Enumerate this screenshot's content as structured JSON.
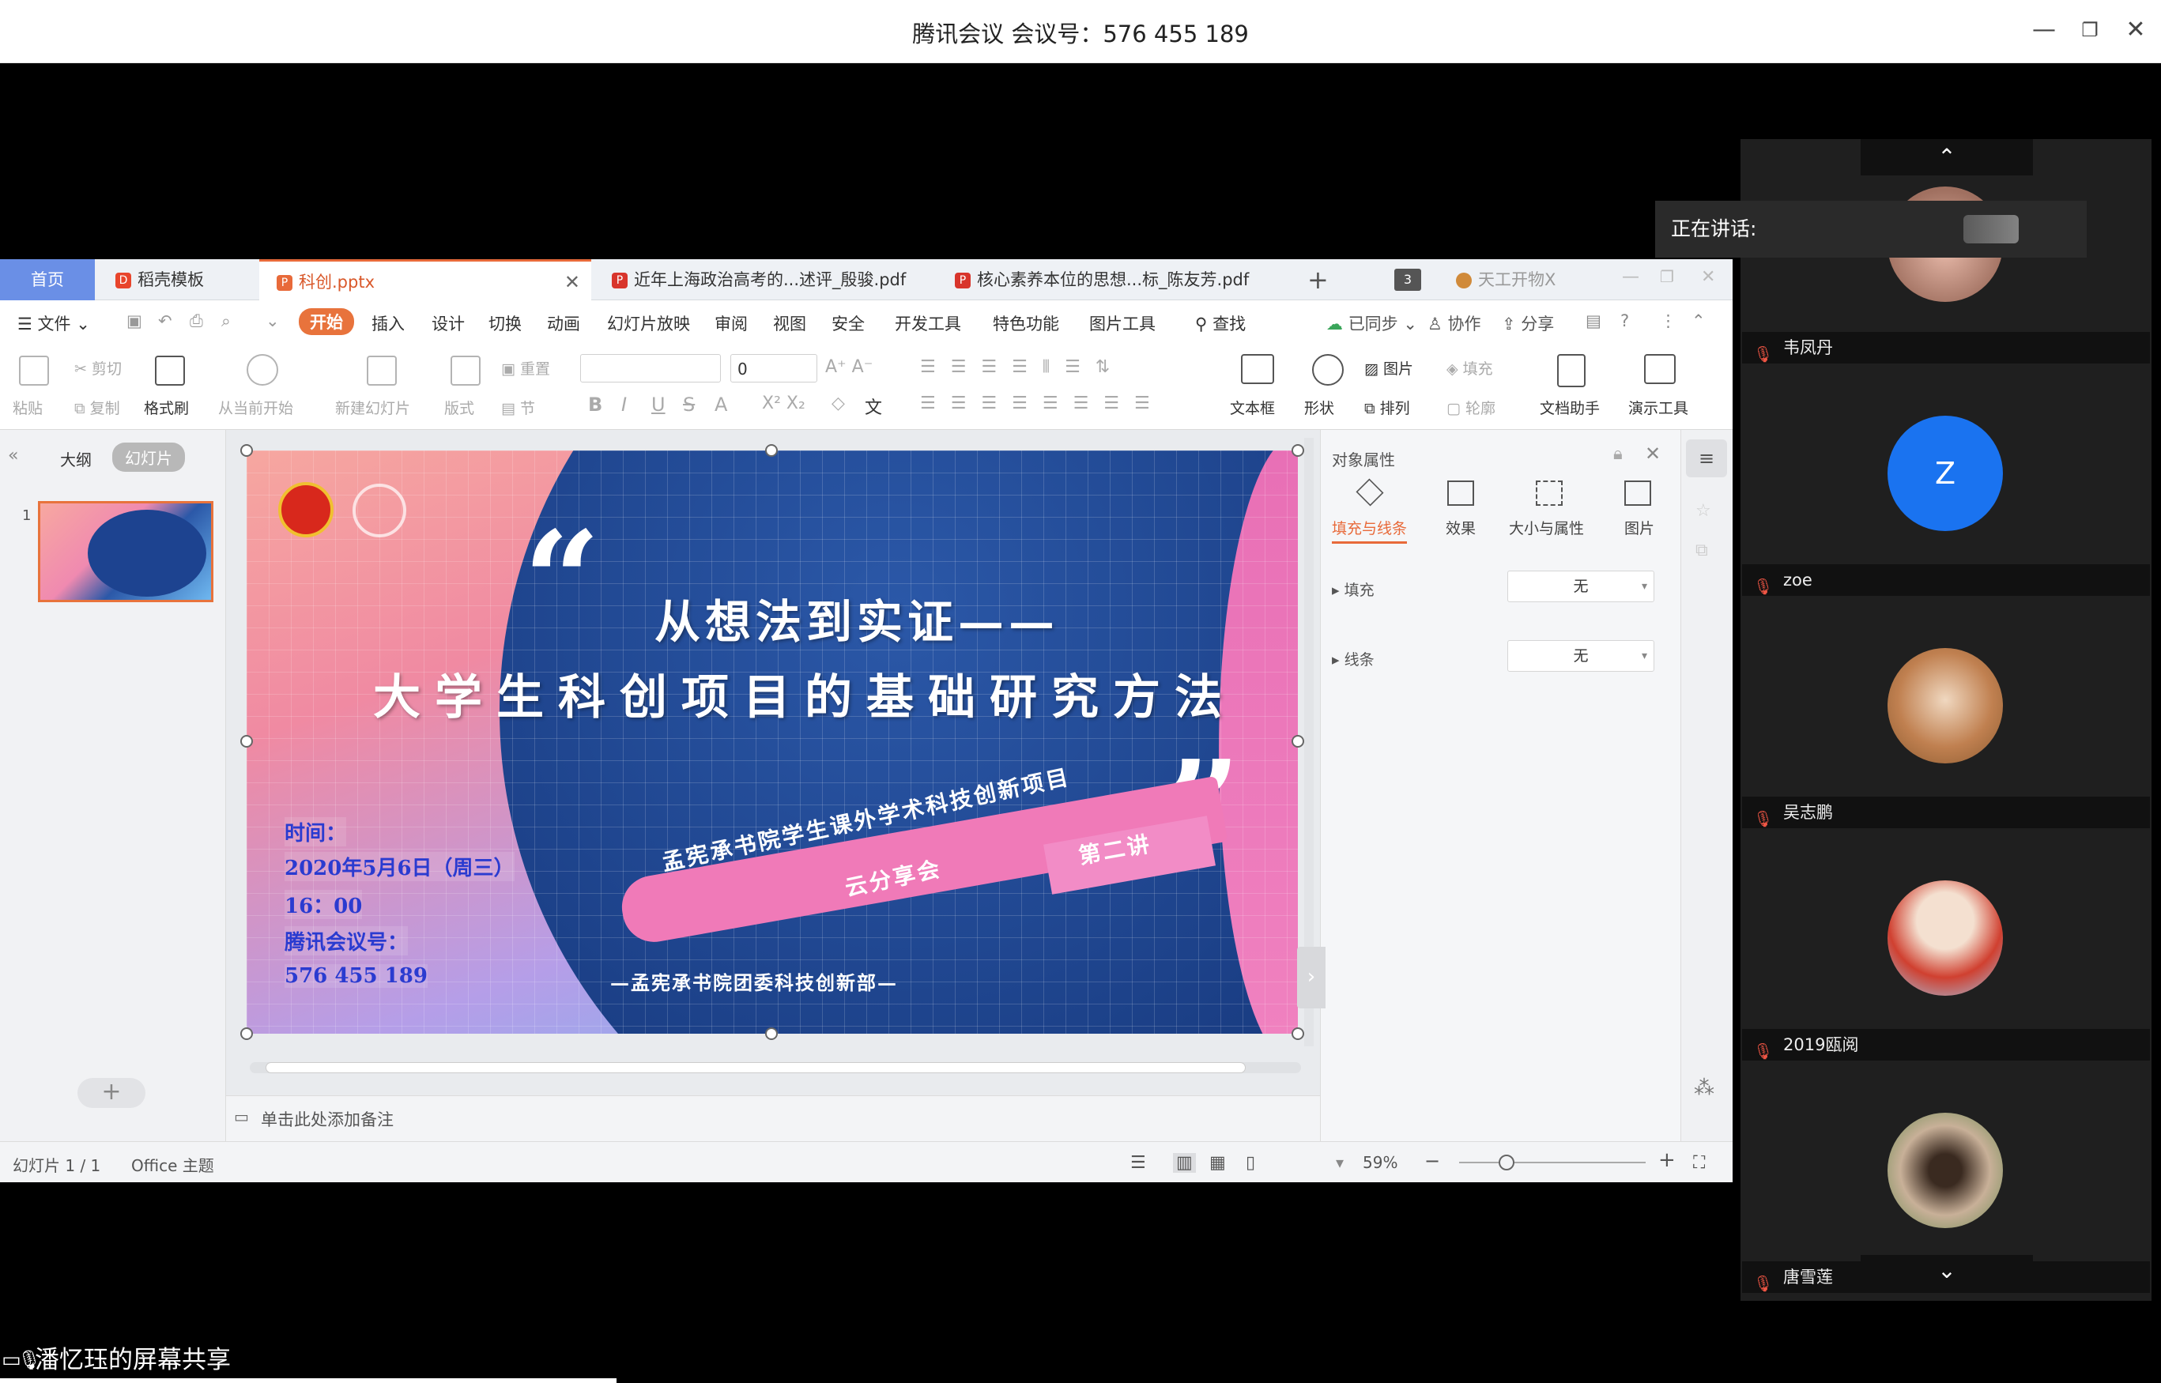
{
  "app": {
    "title": "腾讯会议 会议号：576 455 189"
  },
  "tabs": [
    {
      "label": "首页"
    },
    {
      "label": "稻壳模板"
    },
    {
      "label": "科创.pptx"
    },
    {
      "label": "近年上海政治高考的...述评_殷骏.pdf"
    },
    {
      "label": "核心素养本位的思想...标_陈友芳.pdf"
    },
    {
      "label": "天工开物X"
    }
  ],
  "tab_count_badge": "3",
  "menu": {
    "file": "文件",
    "items": [
      "开始",
      "插入",
      "设计",
      "切换",
      "动画",
      "幻灯片放映",
      "审阅",
      "视图",
      "安全",
      "开发工具",
      "特色功能",
      "图片工具"
    ],
    "search": "查找",
    "synced": "已同步",
    "collab": "协作",
    "share": "分享"
  },
  "ribbon": {
    "paste": "粘贴",
    "cut": "剪切",
    "copy": "复制",
    "format_painter": "格式刷",
    "from_current": "从当前开始",
    "new_slide": "新建幻灯片",
    "layout": "版式",
    "reset": "重置",
    "section": "节",
    "font_size": "0",
    "textbox": "文本框",
    "shape": "形状",
    "picture": "图片",
    "arrange": "排列",
    "fill": "填充",
    "outline": "轮廓",
    "doc_helper": "文档助手",
    "present_tools": "演示工具"
  },
  "left_panel": {
    "outline_tab": "大纲",
    "slides_tab": "幻灯片",
    "slide_number": "1"
  },
  "slide": {
    "title_line1": "从想法到实证——",
    "title_line2": "大学生科创项目的基础研究方法",
    "time_label": "时间：",
    "date": "2020年5月6日（周三）",
    "time": "16：00",
    "meeting_label": "腾讯会议号：",
    "meeting_id": "576 455 189",
    "banner_line1": "孟宪承书院学生课外学术科技创新项目",
    "banner_line2": "云分享会",
    "lecture": "第二讲",
    "footer": "—孟宪承书院团委科技创新部—"
  },
  "props_panel": {
    "title": "对象属性",
    "tabs": [
      "填充与线条",
      "效果",
      "大小与属性",
      "图片"
    ],
    "fill_label": "填充",
    "fill_value": "无",
    "line_label": "线条",
    "line_value": "无"
  },
  "notes_placeholder": "单击此处添加备注",
  "status": {
    "slide_info": "幻灯片 1 / 1",
    "theme": "Office 主题",
    "zoom": "59%"
  },
  "speaking": "正在讲话:",
  "participants": [
    {
      "name": "韦凤丹"
    },
    {
      "name": "zoe",
      "initial": "Z"
    },
    {
      "name": "吴志鹏"
    },
    {
      "name": "2019瓯阅"
    },
    {
      "name": "唐雪莲"
    }
  ],
  "screen_share": "潘忆珏的屏幕共享"
}
